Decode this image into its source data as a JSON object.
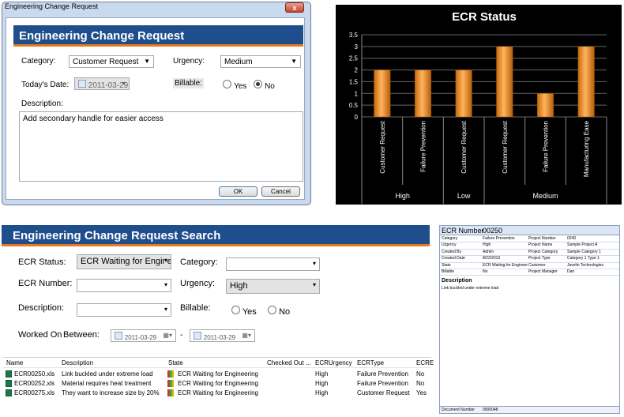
{
  "dialog": {
    "window_title": "Engineering Change Request",
    "close_glyph": "x",
    "header": "Engineering Change Request",
    "category_label": "Category:",
    "category_value": "Customer Request",
    "urgency_label": "Urgency:",
    "urgency_value": "Medium",
    "date_label": "Today's Date:",
    "date_value": "2011-03-29",
    "billable_label": "Billable:",
    "yes_label": "Yes",
    "no_label": "No",
    "billable_selected": "No",
    "description_label": "Description:",
    "description_value": "Add secondary handle for easier access",
    "ok_label": "OK",
    "cancel_label": "Cancel"
  },
  "chart_data": {
    "type": "bar",
    "title": "ECR Status",
    "categories": [
      "Customer Request",
      "Failure Prevention",
      "Customer Request",
      "Customer Request",
      "Failure Prevention",
      "Manufacturing Ease"
    ],
    "groups": [
      {
        "label": "High",
        "count": 2
      },
      {
        "label": "Low",
        "count": 1
      },
      {
        "label": "Medium",
        "count": 3
      }
    ],
    "values": [
      2,
      2,
      2,
      3,
      1,
      3
    ],
    "ylim": [
      0,
      3.5
    ],
    "yticks": [
      "0",
      "0.5",
      "1",
      "1.5",
      "2",
      "2.5",
      "3",
      "3.5"
    ],
    "bar_color": "#f5a13a",
    "background": "#000000",
    "grid": true
  },
  "search": {
    "header": "Engineering Change Request Search",
    "status_label": "ECR Status:",
    "status_value": "ECR Waiting for Engine",
    "category_label": "Category:",
    "category_value": "",
    "number_label": "ECR Number:",
    "number_value": "",
    "urgency_label": "Urgency:",
    "urgency_value": "High",
    "description_label": "Description:",
    "description_value": "",
    "billable_label": "Billable:",
    "yes_label": "Yes",
    "no_label": "No",
    "worked_on_label": "Worked On",
    "between_label": "Between:",
    "date_from": "2011-03-29",
    "date_sep": "-",
    "date_to": "2011-03-29",
    "columns": [
      "Name",
      "Description",
      "State",
      "Checked Out ...",
      "ECRUrgency",
      "ECRType",
      "ECRE"
    ],
    "rows": [
      {
        "name": "ECR00250.xls",
        "description": "Link buckled under extreme load",
        "state": "ECR Waiting for Engineering",
        "checked_out": "",
        "urgency": "High",
        "type": "Failure Prevention",
        "ecre": "No"
      },
      {
        "name": "ECR00252.xls",
        "description": "Material requires heat treatment",
        "state": "ECR Waiting for Engineering",
        "checked_out": "",
        "urgency": "High",
        "type": "Failure Prevention",
        "ecre": "No"
      },
      {
        "name": "ECR00275.xls",
        "description": "They want to increase size by 20%",
        "state": "ECR Waiting for Engineering",
        "checked_out": "",
        "urgency": "High",
        "type": "Customer Request",
        "ecre": "Yes"
      }
    ]
  },
  "report": {
    "number_label": "ECR Number",
    "number_value": "00250",
    "fields": [
      {
        "l1": "Category",
        "v1": "Failure Prevention",
        "l2": "Project Number",
        "v2": "0240"
      },
      {
        "l1": "Urgency",
        "v1": "High",
        "l2": "Project Name",
        "v2": "Sample Project A"
      },
      {
        "l1": "Created By",
        "v1": "Admin",
        "l2": "Project Category",
        "v2": "Sample Category 1"
      },
      {
        "l1": "Created Date",
        "v1": "8/22/2010",
        "l2": "Project Type",
        "v2": "Category 1 Type 1"
      },
      {
        "l1": "State",
        "v1": "ECR Waiting for Engineer",
        "l2": "Customer",
        "v2": "Javelin Technologies"
      },
      {
        "l1": "Billable",
        "v1": "No",
        "l2": "Project Manager",
        "v2": "Dan"
      }
    ],
    "description_label": "Description",
    "description_value": "Link buckled under extreme load",
    "doc_label": "Document Number",
    "doc_value": "0000048"
  }
}
